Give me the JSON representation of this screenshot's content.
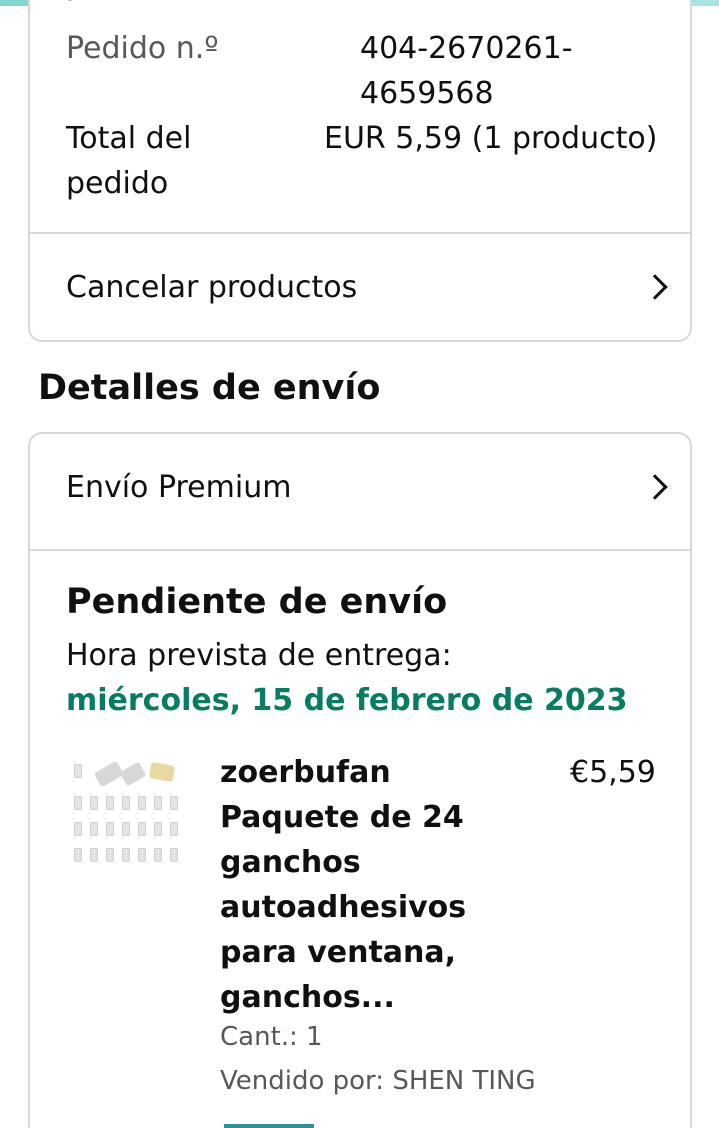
{
  "order": {
    "cut_label": "pedido",
    "number_label": "Pedido n.º",
    "number_value_line1": "404-2670261-",
    "number_value_line2": "4659568",
    "total_label_line1": "Total del",
    "total_label_line2": "pedido",
    "total_value": "EUR 5,59 (1 producto)",
    "cancel_label": "Cancelar productos"
  },
  "shipping": {
    "section_title": "Detalles de envío",
    "method_label": "Envío Premium",
    "status": "Pendiente de envío",
    "eta_label": "Hora prevista de entrega:",
    "eta_date": "miércoles, 15 de febrero de 2023"
  },
  "item": {
    "title_lines": [
      "zoerbufan",
      "Paquete de 24",
      "ganchos",
      "autoadhesivos",
      "para ventana,",
      "ganchos..."
    ],
    "price": "€5,59",
    "quantity": "Cant.: 1",
    "seller": "Vendido por: SHEN TING"
  },
  "icons": {
    "chevron": "chevron-right-icon"
  },
  "colors": {
    "accent_green": "#067d62",
    "border": "#d5d9d9"
  }
}
